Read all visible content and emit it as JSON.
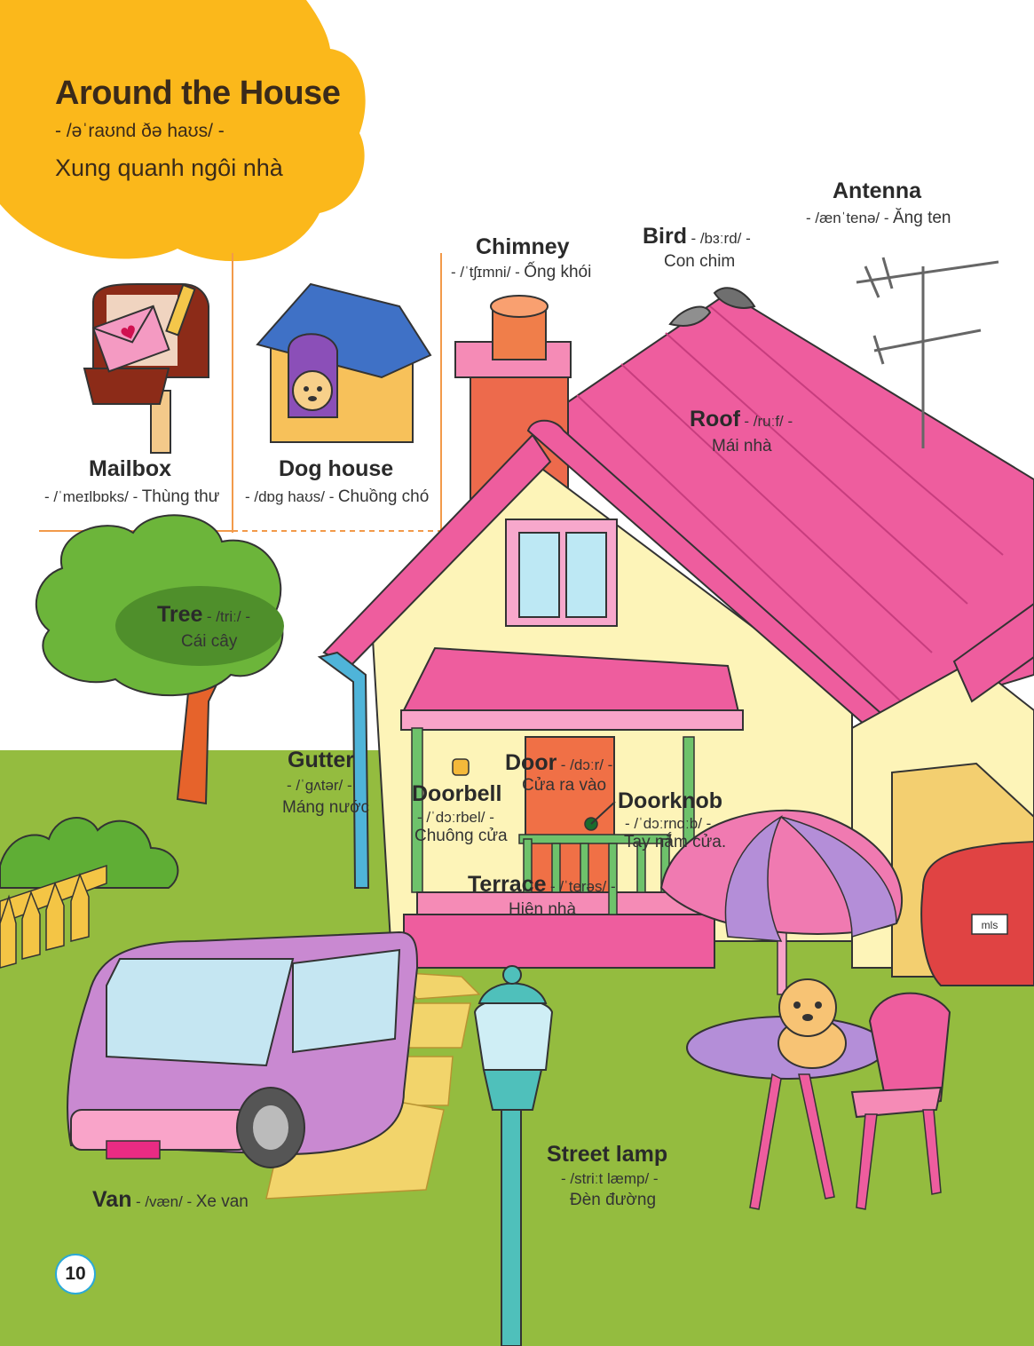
{
  "title": {
    "english": "Around the House",
    "pronunciation": "- /əˈraʊnd ðə haʊs/ -",
    "vietnamese": "Xung quanh ngôi nhà"
  },
  "page_number": "10",
  "colors": {
    "title_blob": "#fbb81b",
    "grass": "#8fb83a",
    "roof": "#ee5d9e",
    "house_wall": "#fdf4b8",
    "van": "#c989d1",
    "lamp": "#3cb8b3"
  },
  "vocabulary": {
    "mailbox": {
      "word": "Mailbox",
      "pron": "- /ˈmeɪlbɒks/ -",
      "meaning": "Thùng thư"
    },
    "dog_house": {
      "word": "Dog house",
      "pron": "- /dɒg haʊs/ -",
      "meaning": "Chuồng chó"
    },
    "chimney": {
      "word": "Chimney",
      "pron": "- /ˈtʃɪmni/ -",
      "meaning": "Ống khói"
    },
    "bird": {
      "word": "Bird",
      "pron": "- /bɜːrd/ -",
      "meaning": "Con chim"
    },
    "antenna": {
      "word": "Antenna",
      "pron": "- /ænˈtenə/ -",
      "meaning": "Ăng ten"
    },
    "roof": {
      "word": "Roof",
      "pron": "- /ruːf/ -",
      "meaning": "Mái nhà"
    },
    "tree": {
      "word": "Tree",
      "pron": "- /triː/ -",
      "meaning": "Cái cây"
    },
    "gutter": {
      "word": "Gutter",
      "pron": "- /ˈɡʌtər/ -",
      "meaning": "Máng nước"
    },
    "door": {
      "word": "Door",
      "pron": "- /dɔːr/ -",
      "meaning": "Cửa ra vào"
    },
    "doorbell": {
      "word": "Doorbell",
      "pron": "- /ˈdɔːrbel/ -",
      "meaning": "Chuông cửa"
    },
    "doorknob": {
      "word": "Doorknob",
      "pron": "- /ˈdɔːrnɑːb/ -",
      "meaning": "Tay nắm cửa."
    },
    "terrace": {
      "word": "Terrace",
      "pron": "- /ˈterəs/ -",
      "meaning": "Hiên nhà"
    },
    "street_lamp": {
      "word": "Street lamp",
      "pron": "- /striːt læmp/ -",
      "meaning": "Đèn đường"
    },
    "van": {
      "word": "Van",
      "pron": "- /væn/ -",
      "meaning": "Xe van"
    }
  },
  "car_plate": "mls"
}
